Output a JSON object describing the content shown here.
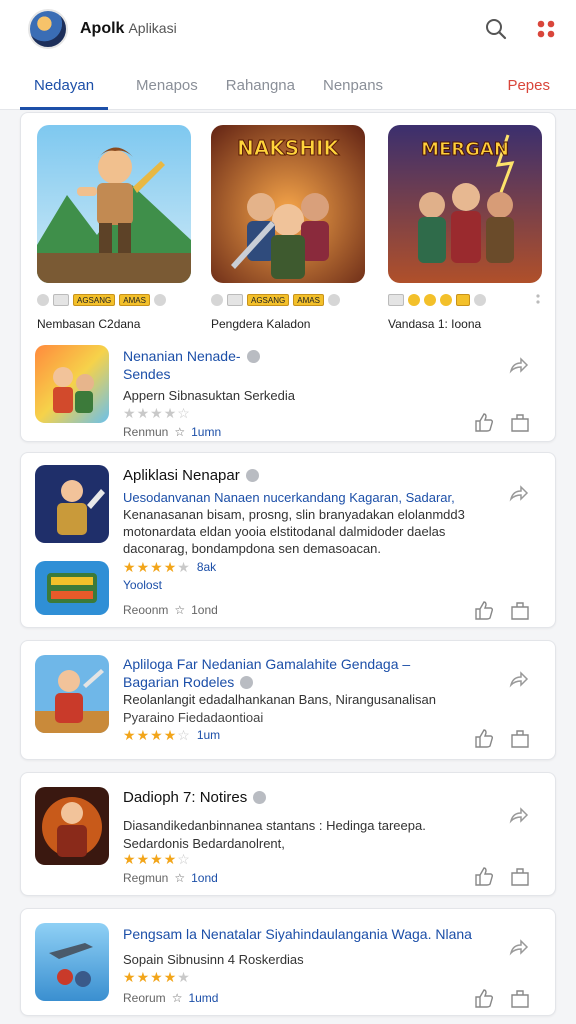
{
  "header": {
    "app_title": "Apolk",
    "app_subtitle": "Aplikasi"
  },
  "tabs": [
    {
      "label": "Nedayan"
    },
    {
      "label": "Menapos"
    },
    {
      "label": "Rahangna"
    },
    {
      "label": "Nenpans"
    },
    {
      "label": "Pepes"
    }
  ],
  "featured": [
    {
      "name": "Nembasan C2dana",
      "art_title": ""
    },
    {
      "name": "Pengdera Kaladon",
      "art_title": "NAKSHIK"
    },
    {
      "name": "Vandasa 1: Ioona",
      "art_title": "MERGAN"
    }
  ],
  "featured_badges": [
    "AGSANG",
    "AMAS"
  ],
  "list": [
    {
      "title_line1": "Nenanian Nenade-",
      "title_line2": "Sendes",
      "desc": "Appern Sibnasuktan Serkedia",
      "stars": 4,
      "meta_label": "Renmun",
      "meta_value": "1umn"
    },
    {
      "title_line1": "Apliklasi Nenapar",
      "desc_lines": [
        "Uesodanvanan Nanaen nucerkandang Kagaran, Sadarar,",
        "Kenanasanan bisam, prosng, slin branyadakan elolanmdd3",
        "motonardata eldan yooia elstitodanal dalmidoder daelas",
        "daconarag, bondampdona sen demasoacan."
      ],
      "stars": 4,
      "rating_extra": "8ak",
      "tag": "Yoolost",
      "meta_label": "Reoonm",
      "meta_value": "1ond"
    },
    {
      "title_line1": "Apliloga Far Nedanian Gamalahite Gendaga –",
      "title_line2": "Bagarian Rodeles",
      "desc": "Reolanlangit edadalhankanan Bans, Nirangusanalisan",
      "desc2": "Pyaraino Fiedadaontioai",
      "stars": 4,
      "meta_label": "",
      "meta_value": "1um"
    },
    {
      "title_line1": "Dadioph 7: Notires",
      "desc": "Diasandikedanbinnanea stantans : Hedinga tareepa.",
      "desc2": "Sedardonis Bedardanolrent,",
      "stars": 4,
      "meta_label": "Regmun",
      "meta_value": "1ond"
    },
    {
      "title_line1": "Pengsam la Nenatalar Siyahindaulangania Waga. Nlana",
      "desc": "Sopain Sibnusinn 4 Roskerdias",
      "stars": 4,
      "meta_label": "Reorum",
      "meta_value": "1umd"
    }
  ],
  "colors": {
    "accent": "#1c4fa8",
    "alert": "#d9463b",
    "star": "#f2a51a"
  }
}
